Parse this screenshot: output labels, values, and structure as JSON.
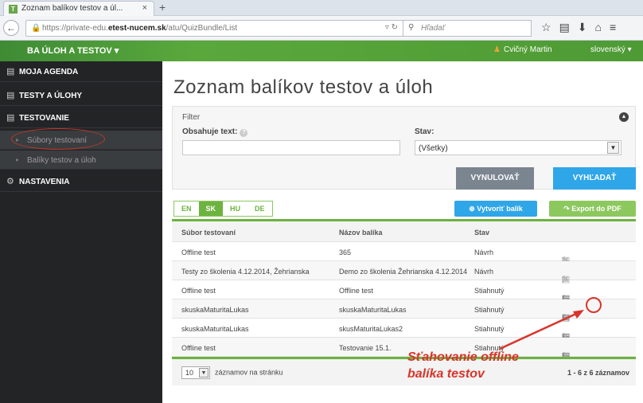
{
  "browser": {
    "tab_title": "Zoznam balíkov testov a úl...",
    "tab_close": "×",
    "new_tab": "+",
    "url_prefix": "https://private-edu.",
    "url_domain": "etest-nucem.sk",
    "url_path": "/atu/QuizBundle/List",
    "search_placeholder": "Hľadať"
  },
  "appbar": {
    "brand": "BA ÚLOH A TESTOV ▾",
    "user": "Cvičný Martin",
    "language": "slovenský ▾"
  },
  "sidebar": {
    "items": [
      {
        "label": "MOJA AGENDA",
        "icon": "calendar-icon"
      },
      {
        "label": "TESTY A ÚLOHY",
        "icon": "document-icon"
      },
      {
        "label": "TESTOVANIE",
        "icon": "document-icon"
      },
      {
        "label": "Súbory testovaní",
        "icon": "bullet"
      },
      {
        "label": "Balíky testov a úloh",
        "icon": "bullet"
      },
      {
        "label": "NASTAVENIA",
        "icon": "gear-icon"
      }
    ]
  },
  "page": {
    "title": "Zoznam balíkov testov a úloh"
  },
  "filter": {
    "label": "Filter",
    "text_label": "Obsahuje text:",
    "text_value": "",
    "status_label": "Stav:",
    "status_value": "(Všetky)",
    "reset_label": "VYNULOVAŤ",
    "search_label": "VYHĽADAŤ"
  },
  "lang_tabs": [
    "EN",
    "SK",
    "HU",
    "DE"
  ],
  "active_lang": "SK",
  "actions": {
    "create_label": "Vytvoriť balík",
    "pdf_label": "Export do PDF"
  },
  "table": {
    "headers": [
      "Súbor testovaní",
      "Názov balíka",
      "Stav"
    ],
    "rows": [
      [
        "Offline test",
        "365",
        "Návrh"
      ],
      [
        "Testy zo školenia 4.12.2014, Žehrianska",
        "Demo zo školenia Žehrianska 4.12.2014",
        "Návrh"
      ],
      [
        "Offline test",
        "Offline test",
        "Stiahnutý"
      ],
      [
        "skuskaMaturitaLukas",
        "skuskaMaturitaLukas",
        "Stiahnutý"
      ],
      [
        "skuskaMaturitaLukas",
        "skusMaturitaLukas2",
        "Stiahnutý"
      ],
      [
        "Offline test",
        "Testovanie 15.1.",
        "Stiahnutý"
      ]
    ]
  },
  "pager": {
    "page_size": "10",
    "per_page_label": "záznamov na stránku",
    "count": "1 - 6 z 6 záznamov"
  },
  "annotation": {
    "line1": "Sťahovanie offline",
    "line2": "balíka testov"
  },
  "colors": {
    "green": "#6cb33f",
    "blue": "#2fa6e8",
    "gray_button": "#7a8590",
    "sidebar": "#222426",
    "annotation_red": "#d9342a"
  }
}
